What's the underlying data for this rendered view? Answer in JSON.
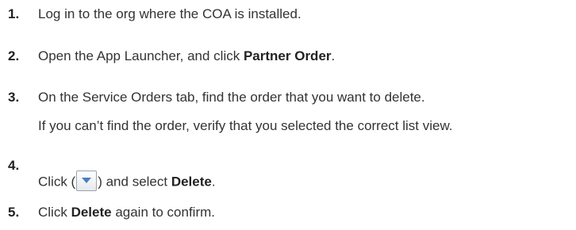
{
  "steps": [
    {
      "number": "1.",
      "text": "Log in to the org where the COA is installed."
    },
    {
      "number": "2.",
      "before": "Open the App Launcher, and click ",
      "bold": "Partner Order",
      "after": "."
    },
    {
      "number": "3.",
      "text": "On the Service Orders tab, find the order that you want to delete.",
      "note": "If you can’t find the order, verify that you selected the correct list view."
    },
    {
      "number": "4.",
      "before": "Click (",
      "icon": "dropdown-arrow-icon",
      "middle": ") and select ",
      "bold": "Delete",
      "after": "."
    },
    {
      "number": "5.",
      "before": "Click ",
      "bold": "Delete",
      "after": " again to confirm."
    }
  ],
  "colors": {
    "text": "#333333",
    "icon_arrow": "#4a7fc0"
  }
}
